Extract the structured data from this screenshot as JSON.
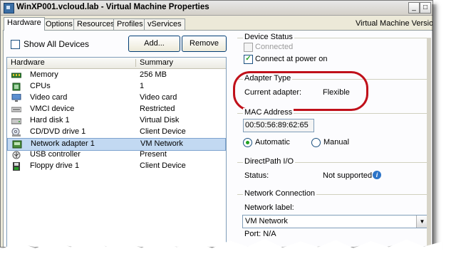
{
  "window": {
    "title": "WinXP001.vcloud.lab - Virtual Machine Properties",
    "controls": {
      "minimize": "_",
      "maximize": "□"
    }
  },
  "tabs": [
    {
      "label": "Hardware",
      "active": true
    },
    {
      "label": "Options",
      "active": false
    },
    {
      "label": "Resources",
      "active": false
    },
    {
      "label": "Profiles",
      "active": false
    },
    {
      "label": "vServices",
      "active": false
    }
  ],
  "vm_version_label": "Virtual Machine Version:",
  "toolbar": {
    "show_all_devices_label": "Show All Devices",
    "show_all_devices_checked": false,
    "add_label": "Add...",
    "remove_label": "Remove"
  },
  "device_list": {
    "columns": [
      "Hardware",
      "Summary"
    ],
    "rows": [
      {
        "name": "Memory",
        "summary": "256 MB",
        "icon": "memory-icon",
        "selected": false
      },
      {
        "name": "CPUs",
        "summary": "1",
        "icon": "cpu-icon",
        "selected": false
      },
      {
        "name": "Video card",
        "summary": "Video card",
        "icon": "monitor-icon",
        "selected": false
      },
      {
        "name": "VMCI device",
        "summary": "Restricted",
        "icon": "vmci-icon",
        "selected": false
      },
      {
        "name": "Hard disk 1",
        "summary": "Virtual Disk",
        "icon": "harddisk-icon",
        "selected": false
      },
      {
        "name": "CD/DVD drive 1",
        "summary": "Client Device",
        "icon": "cdrom-icon",
        "selected": false
      },
      {
        "name": "Network adapter 1",
        "summary": "VM Network",
        "icon": "network-icon",
        "selected": true
      },
      {
        "name": "USB controller",
        "summary": "Present",
        "icon": "usb-icon",
        "selected": false
      },
      {
        "name": "Floppy drive 1",
        "summary": "Client Device",
        "icon": "floppy-icon",
        "selected": false
      }
    ]
  },
  "device_status": {
    "title": "Device Status",
    "connected_label": "Connected",
    "connected_checked": false,
    "connected_enabled": false,
    "connect_at_power_on_label": "Connect at power on",
    "connect_at_power_on_checked": true
  },
  "adapter_type": {
    "title": "Adapter Type",
    "current_adapter_label": "Current adapter:",
    "current_adapter_value": "Flexible"
  },
  "mac_address": {
    "title": "MAC Address",
    "value": "00:50:56:89:62:65",
    "automatic_label": "Automatic",
    "manual_label": "Manual",
    "selected": "Automatic"
  },
  "directpath": {
    "title": "DirectPath I/O",
    "status_label": "Status:",
    "status_value": "Not supported"
  },
  "network_connection": {
    "title": "Network Connection",
    "network_label_label": "Network label:",
    "network_label_value": "VM Network",
    "port_label": "Port: N/A"
  },
  "colors": {
    "highlight_ring": "#c0101a",
    "selection": "#c2d9f2",
    "check_green": "#21a121",
    "panel": "#ece9d8"
  }
}
